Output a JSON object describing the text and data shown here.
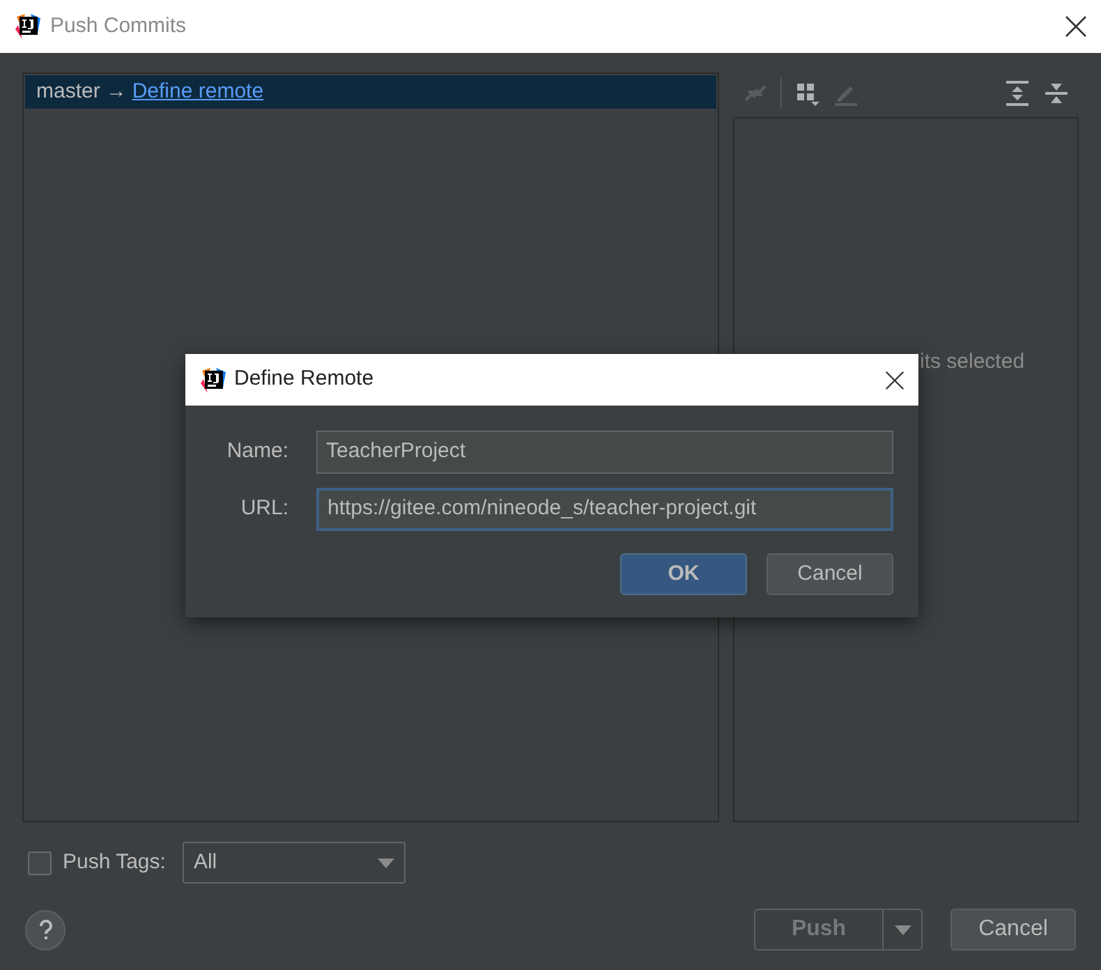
{
  "window": {
    "title": "Push Commits"
  },
  "branch_row": {
    "branch": "master",
    "arrow": "→",
    "link": "Define remote",
    "selected": true
  },
  "toolbar": [
    {
      "kind": "merge",
      "disabled": true
    },
    {
      "kind": "group",
      "disabled": false
    },
    {
      "kind": "edit",
      "disabled": true
    },
    {
      "kind": "expand",
      "disabled": false
    },
    {
      "kind": "collapse",
      "disabled": false
    }
  ],
  "details": {
    "empty_text": "its selected"
  },
  "push_tags": {
    "label": "Push Tags:",
    "checked": false,
    "value": "All"
  },
  "buttons": [
    {
      "label": "Push",
      "kind": "split",
      "disabled": true
    },
    {
      "label": "Cancel",
      "kind": "plain",
      "disabled": false
    }
  ],
  "dialog": {
    "title": "Define Remote",
    "fields": [
      {
        "label": "Name:",
        "value": "TeacherProject",
        "focused": false
      },
      {
        "label": "URL:",
        "value": "https://gitee.com/nineode_s/teacher-project.git",
        "focused": true
      }
    ],
    "buttons": [
      {
        "label": "OK",
        "default": true
      },
      {
        "label": "Cancel",
        "default": false
      }
    ]
  }
}
